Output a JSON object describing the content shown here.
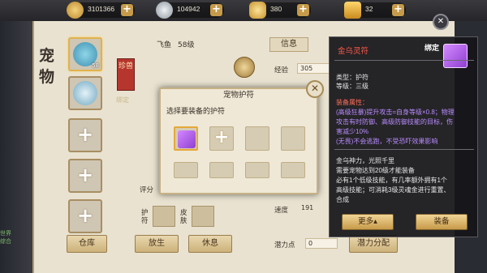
{
  "resources": [
    {
      "icon": "gold-coin-icon",
      "value": "3101366",
      "color": "#d8a94a"
    },
    {
      "icon": "silver-coin-icon",
      "value": "104942",
      "color": "#bfc7cf"
    },
    {
      "icon": "gold-ingot-icon",
      "value": "380",
      "color": "#e2b64a"
    },
    {
      "icon": "gold-bar-icon",
      "value": "32",
      "color": "#e8b23c"
    }
  ],
  "page": {
    "title": "宠物",
    "pet_name": "飞鱼",
    "pet_level": "58级",
    "tag_text": "珍兽",
    "tag_sub": "绑定",
    "pet_slot_1_level": "58",
    "tab_info": "信息",
    "stats": [
      {
        "label": "经验",
        "value": "305"
      },
      {
        "label": "速度",
        "value": "191"
      },
      {
        "label": "潜力点",
        "value": "0"
      }
    ],
    "side_labels": {
      "evaluate": "评分",
      "guard": "护符",
      "skin": "皮肤"
    },
    "warehouse_button": "仓库",
    "release_button": "放生",
    "rest_button": "休息",
    "allocate_button": "潜力分配"
  },
  "dialog": {
    "title": "宠物护符",
    "prompt": "选择要装备的护符"
  },
  "tooltip": {
    "name": "金乌灵符",
    "bound": "绑定",
    "type_line": "类型：护符",
    "level_line": "等级：三级",
    "section": "装备属性：",
    "attr_lines": [
      "(高级狂暴)提升攻击=自身等级×0.8；物理",
      "攻击有时防御、高级防御技能的目标，伤",
      "害减少10%",
      "(无畏)不会逃跑，不受恐吓效果影响"
    ],
    "desc_lines": [
      "金乌神力，光照千里",
      "需要宠物达到20级才能装备",
      "必有1个低级技能，有几率额外拥有1个",
      "高级技能；可消耗3级灵魂金进行重置、",
      "合成"
    ],
    "more_button": "更多▴",
    "equip_button": "装备",
    "name_color": "#ff5a4a"
  },
  "chat": {
    "line1": "世界",
    "line2": "综合"
  }
}
